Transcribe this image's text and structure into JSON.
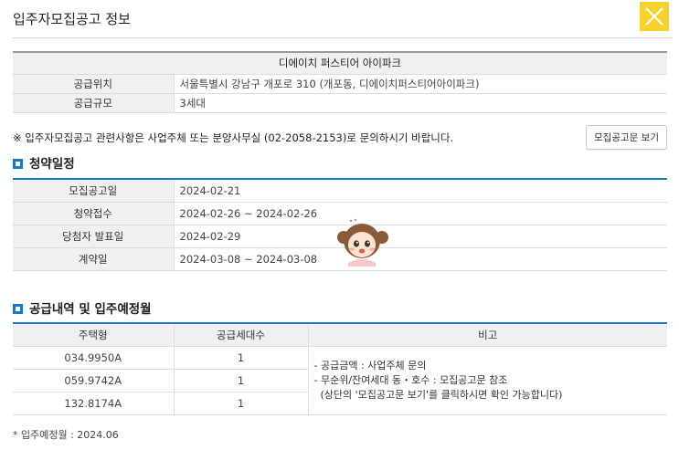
{
  "header": {
    "title": "입주자모집공고 정보"
  },
  "complex": {
    "name": "디에이치 퍼스티어 아이파크",
    "rows": [
      {
        "label": "공급위치",
        "value": "서울특별시 강남구 개포로 310 (개포동, 디에이치퍼스티어아이파크)"
      },
      {
        "label": "공급규모",
        "value": "3세대"
      }
    ]
  },
  "notice": "※ 입주자모집공고 관련사항은 사업주체 또는 분양사무실 (02-2058-2153)로 문의하시기 바랍니다.",
  "doc_button": "모집공고문 보기",
  "schedule": {
    "title": "청약일정",
    "rows": [
      {
        "label": "모집공고일",
        "value": "2024-02-21"
      },
      {
        "label": "청약접수",
        "value": "2024-02-26 ~ 2024-02-26"
      },
      {
        "label": "당첨자 발표일",
        "value": "2024-02-29"
      },
      {
        "label": "계약일",
        "value": "2024-03-08 ~ 2024-03-08"
      }
    ]
  },
  "supply": {
    "title": "공급내역 및 입주예정월",
    "headers": [
      "주택형",
      "공급세대수",
      "비고"
    ],
    "rows": [
      {
        "type": "034.9950A",
        "units": "1"
      },
      {
        "type": "059.9742A",
        "units": "1"
      },
      {
        "type": "132.8174A",
        "units": "1"
      }
    ],
    "notes": [
      "- 공급금액 : 사업주체 문의",
      "- 무순위/잔여세대 동・호수 : 모집공고문 참조",
      "  (상단의 '모집공고문 보기'를 클릭하시면 확인 가능합니다)"
    ]
  },
  "footnote": "* 입주예정월 : 2024.06",
  "colors": {
    "accent": "#1c77c9",
    "close_bg": "#f6d22a"
  },
  "icons": {
    "close": "close-icon",
    "section": "square-bullet-icon",
    "mascot": "mascot-character-icon"
  }
}
